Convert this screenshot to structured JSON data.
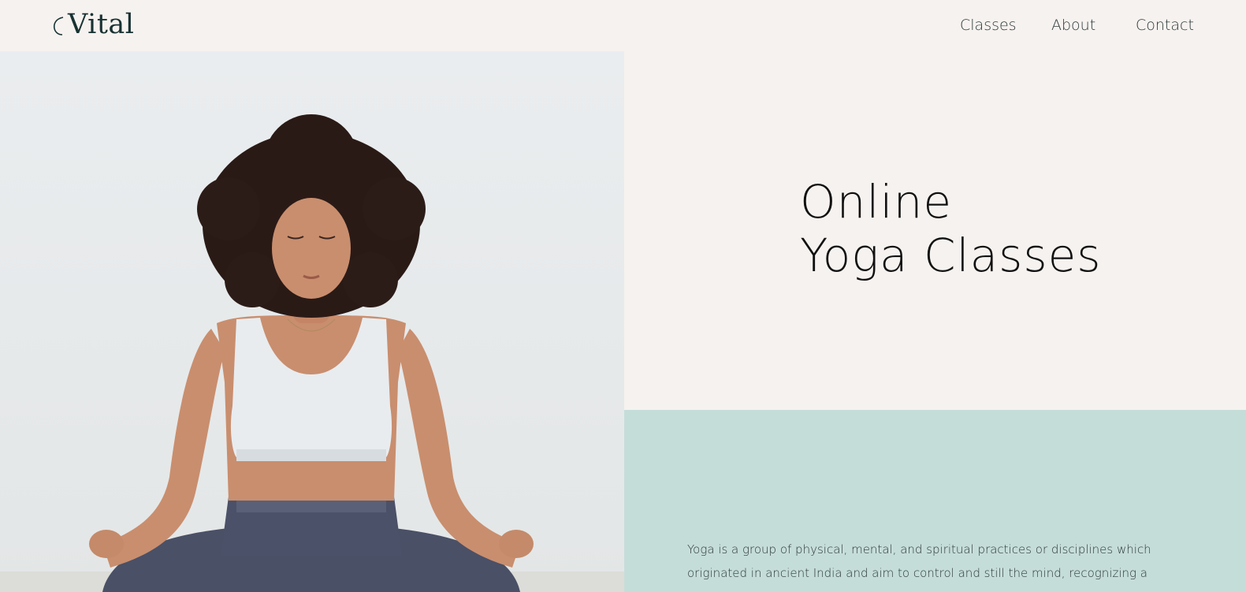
{
  "header": {
    "logo_text": "Vital",
    "nav": {
      "classes": "Classes",
      "about": "About",
      "contact": "Contact"
    }
  },
  "hero": {
    "title_line1": "Online",
    "title_line2": "Yoga  Classes"
  },
  "intro": {
    "description": "Yoga is a group of physical, mental, and spiritual practices or disciplines which originated in ancient India and aim to control and still the mind, recognizing a"
  },
  "colors": {
    "page_bg": "#f6f2ef",
    "accent_teal": "#c5ddd9",
    "logo": "#183233"
  }
}
